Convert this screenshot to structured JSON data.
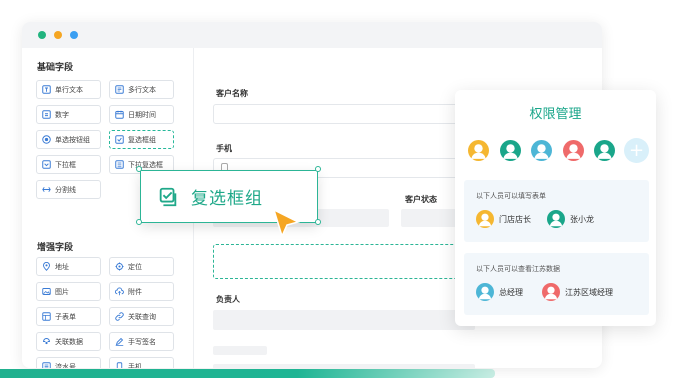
{
  "window": {
    "dots": [
      "#22b47f",
      "#f5a623",
      "#3b9ff2"
    ]
  },
  "sidebar": {
    "basic_title": "基础字段",
    "basic_fields": [
      {
        "label": "单行文本",
        "icon": "single-line-text-icon"
      },
      {
        "label": "多行文本",
        "icon": "multi-line-text-icon"
      },
      {
        "label": "数字",
        "icon": "number-icon"
      },
      {
        "label": "日期时间",
        "icon": "calendar-icon"
      },
      {
        "label": "单选按钮组",
        "icon": "radio-icon"
      },
      {
        "label": "复选框组",
        "icon": "checkbox-icon"
      },
      {
        "label": "下拉框",
        "icon": "dropdown-icon"
      },
      {
        "label": "下拉复选框",
        "icon": "dropdown-multi-icon"
      },
      {
        "label": "分割线",
        "icon": "divider-icon"
      }
    ],
    "advanced_title": "增强字段",
    "advanced_fields": [
      {
        "label": "地址",
        "icon": "map-pin-icon"
      },
      {
        "label": "定位",
        "icon": "locate-icon"
      },
      {
        "label": "图片",
        "icon": "image-icon"
      },
      {
        "label": "附件",
        "icon": "cloud-upload-icon"
      },
      {
        "label": "子表单",
        "icon": "sub-form-icon"
      },
      {
        "label": "关联查询",
        "icon": "link-query-icon"
      },
      {
        "label": "关联数据",
        "icon": "link-data-icon"
      },
      {
        "label": "手写签名",
        "icon": "pen-icon"
      },
      {
        "label": "流水号",
        "icon": "serial-number-icon"
      },
      {
        "label": "手机",
        "icon": "phone-icon"
      }
    ]
  },
  "form": {
    "customer_name_label": "客户名称",
    "phone_label": "手机",
    "customer_status_label": "客户状态",
    "owner_label": "负责人"
  },
  "drag_item": {
    "label": "复选框组",
    "icon": "checkbox-icon"
  },
  "permission": {
    "title": "权限管理",
    "avatar_colors": [
      "#f5b731",
      "#1aa68a",
      "#4db6d6",
      "#ef6a6a",
      "#1aa68a"
    ],
    "fill_card": {
      "title": "以下人员可以填写表单",
      "people": [
        {
          "name": "门店店长",
          "color": "#f5b731"
        },
        {
          "name": "张小龙",
          "color": "#1aa68a"
        }
      ]
    },
    "view_card": {
      "title": "以下人员可以查看江苏数据",
      "people": [
        {
          "name": "总经理",
          "color": "#4db6d6"
        },
        {
          "name": "江苏区域经理",
          "color": "#ef6a6a"
        }
      ]
    }
  }
}
